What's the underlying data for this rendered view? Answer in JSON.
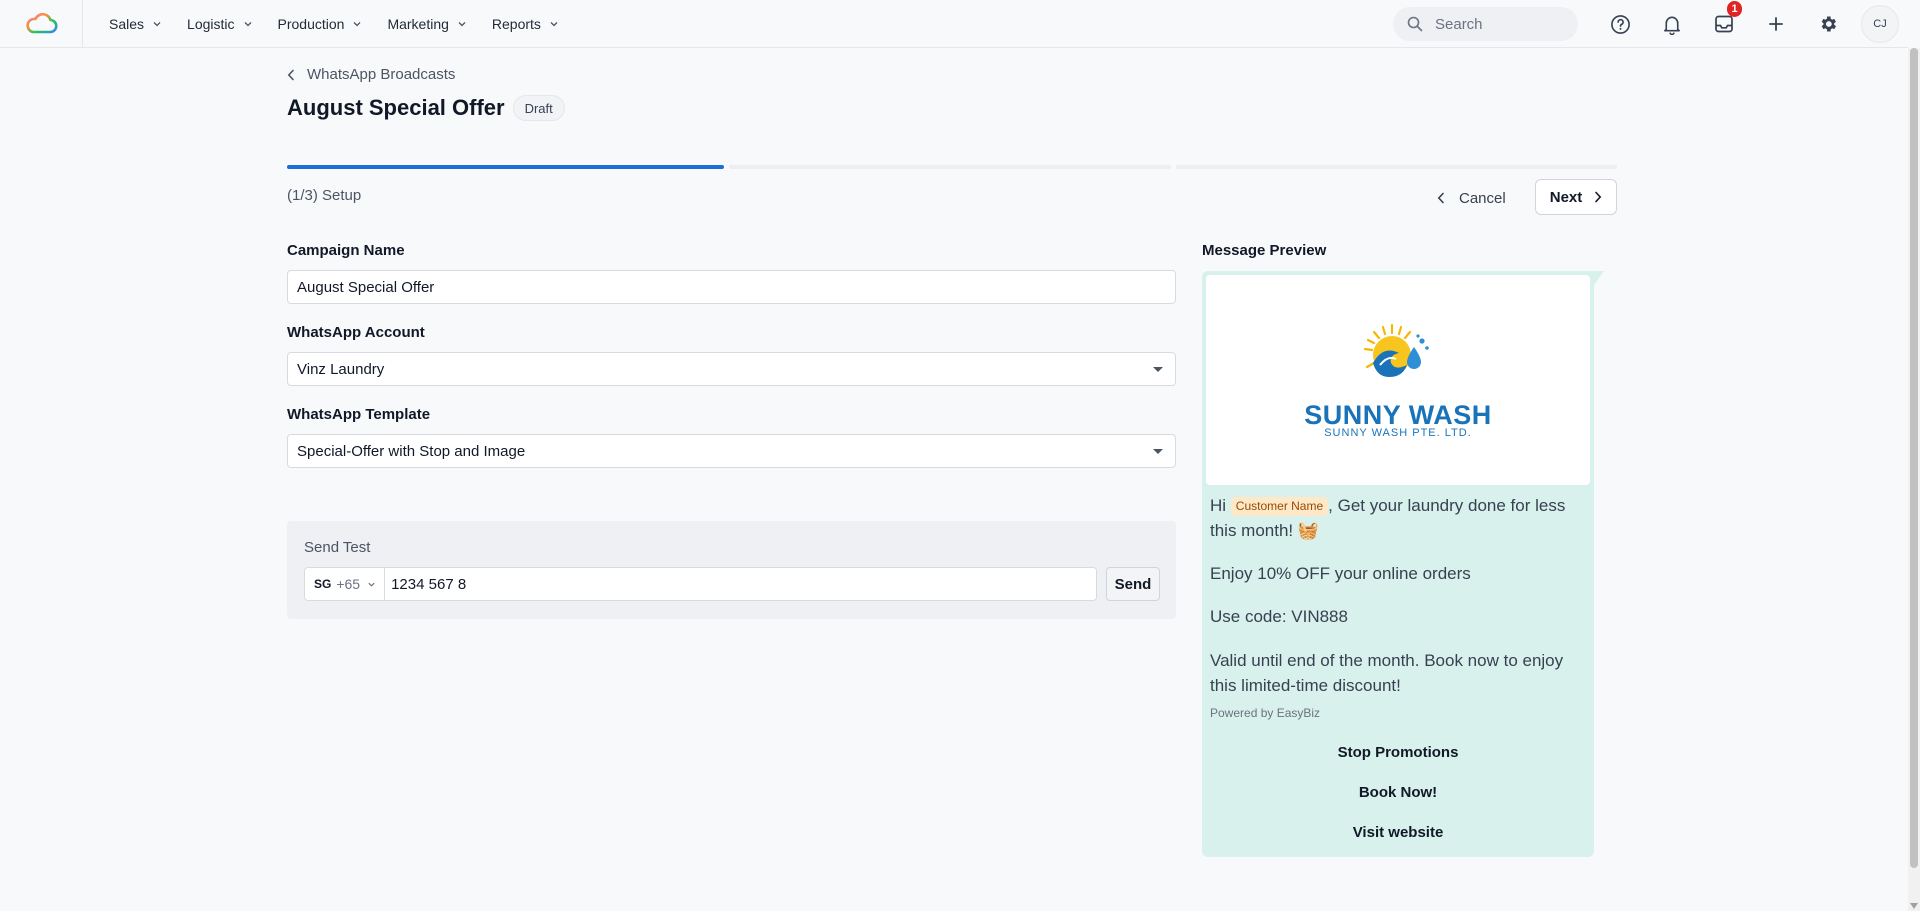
{
  "nav": {
    "items": [
      {
        "label": "Sales"
      },
      {
        "label": "Logistic"
      },
      {
        "label": "Production"
      },
      {
        "label": "Marketing"
      },
      {
        "label": "Reports"
      }
    ],
    "search_placeholder": "Search",
    "inbox_badge": "1",
    "avatar_initials": "CJ"
  },
  "header": {
    "breadcrumb": "WhatsApp Broadcasts",
    "title": "August Special Offer",
    "status": "Draft"
  },
  "wizard": {
    "step_label": "(1/3) Setup",
    "progress_fraction": 0.333,
    "cancel_label": "Cancel",
    "next_label": "Next"
  },
  "form": {
    "campaign_name_label": "Campaign Name",
    "campaign_name_value": "August Special Offer",
    "account_label": "WhatsApp Account",
    "account_value": "Vinz Laundry",
    "template_label": "WhatsApp Template",
    "template_value": "Special-Offer with Stop and Image"
  },
  "send_test": {
    "label": "Send Test",
    "country_flag": "SG",
    "country_code": "+65",
    "phone_value": "1234 567 8",
    "send_label": "Send"
  },
  "preview": {
    "label": "Message Preview",
    "brand_name": "SUNNY WASH",
    "brand_sub": "SUNNY WASH PTE. LTD.",
    "greeting": "Hi",
    "variable_chip": "Customer Name",
    "line1_rest": ", Get your laundry done for less this month! 🧺",
    "line2": "Enjoy 10% OFF your online orders",
    "line3": "Use code: VIN888",
    "line4": "Valid until end of the month. Book now to enjoy this limited-time discount!",
    "footer": "Powered by EasyBiz",
    "buttons": [
      {
        "label": "Stop Promotions"
      },
      {
        "label": "Book Now!"
      },
      {
        "label": "Visit website"
      }
    ]
  },
  "colors": {
    "accent": "#1a6fd8",
    "bubble": "#d9f1ec",
    "badge": "#e02424"
  }
}
